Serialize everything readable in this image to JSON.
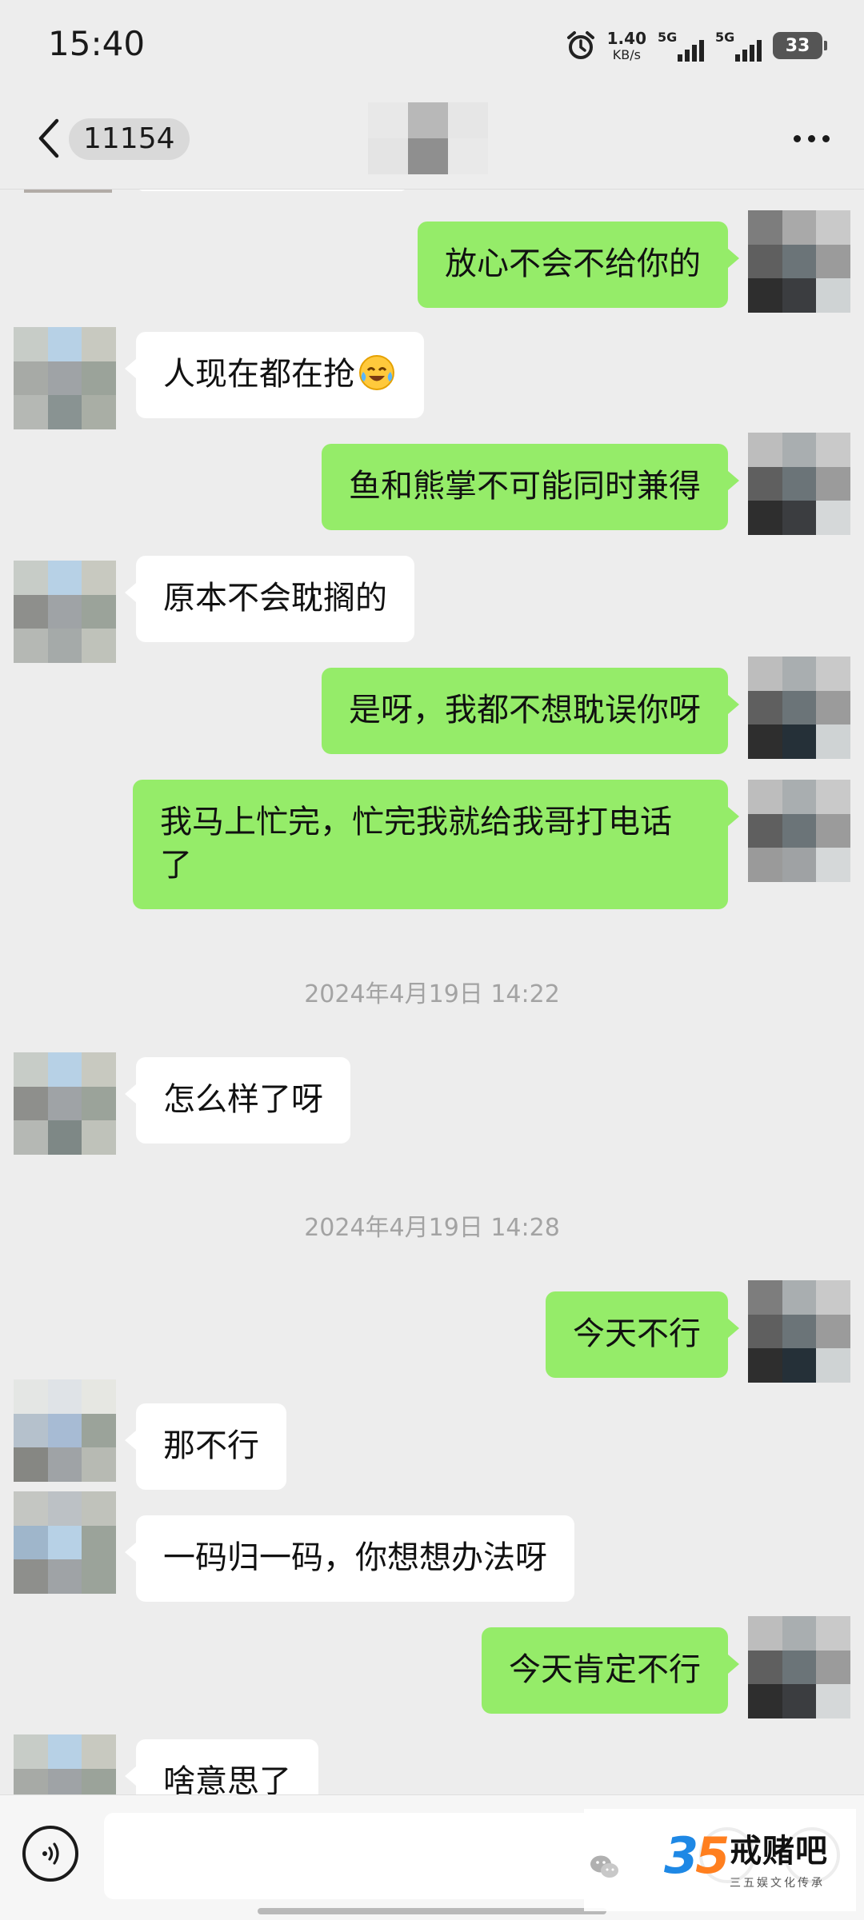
{
  "status_bar": {
    "time": "15:40",
    "net_speed_value": "1.40",
    "net_speed_unit": "KB/s",
    "sim1_label": "5G",
    "sim2_label": "5G",
    "battery_level": "33"
  },
  "header": {
    "back_icon": "chevron-left-icon",
    "unread_count": "11154",
    "more_icon": "more-dots-icon"
  },
  "colors": {
    "background": "#ededed",
    "bubble_outgoing": "#95ec69",
    "bubble_incoming": "#ffffff",
    "timestamp_text": "#a3a3a3"
  },
  "messages": [
    {
      "side": "out",
      "text": "放心不会不给你的"
    },
    {
      "side": "in",
      "text": "人现在都在抢",
      "emoji": "crying-laughing-emoji"
    },
    {
      "side": "out",
      "text": "鱼和熊掌不可能同时兼得"
    },
    {
      "side": "in",
      "text": "原本不会耽搁的"
    },
    {
      "side": "out",
      "text": "是呀，我都不想耽误你呀"
    },
    {
      "side": "out",
      "text": "我马上忙完，忙完我就给我哥打电话了"
    },
    {
      "type": "time",
      "text": "2024年4月19日 14:22"
    },
    {
      "side": "in",
      "text": "怎么样了呀"
    },
    {
      "type": "time",
      "text": "2024年4月19日 14:28"
    },
    {
      "side": "out",
      "text": "今天不行"
    },
    {
      "side": "in",
      "text": "那不行"
    },
    {
      "side": "in",
      "text": "一码归一码，你想想办法呀"
    },
    {
      "side": "out",
      "text": "今天肯定不行"
    },
    {
      "side": "in",
      "text": "啥意思了"
    }
  ],
  "input_bar": {
    "voice_icon": "voice-icon",
    "input_value": "",
    "emoji_icon": "emoji-icon",
    "plus_icon": "plus-icon"
  },
  "watermark": {
    "logo_digit_1": "3",
    "logo_digit_2": "5",
    "name": "戒赌吧",
    "subtitle": "三五娱文化传承"
  }
}
